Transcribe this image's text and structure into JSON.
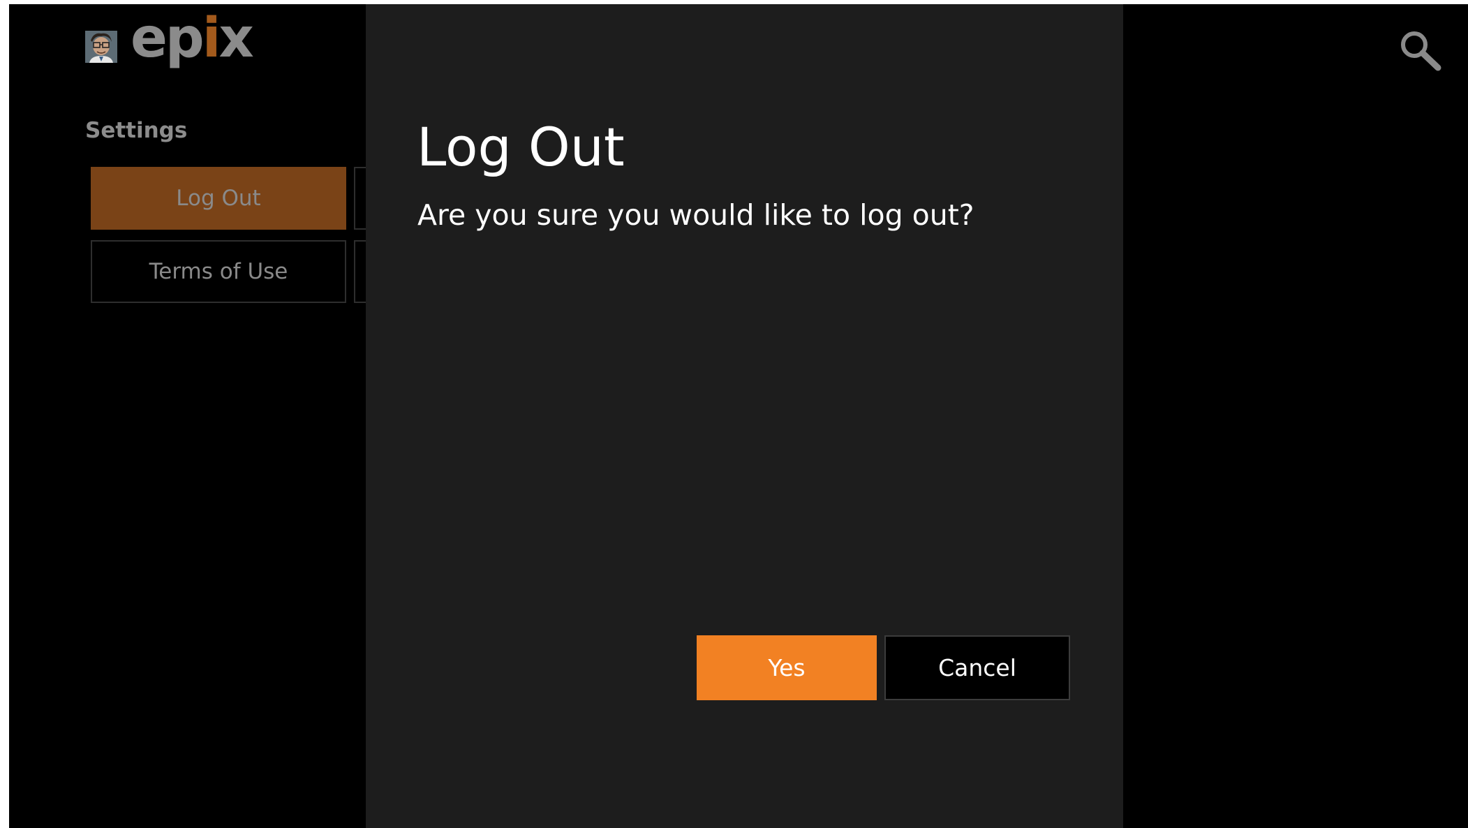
{
  "app": {
    "logo_text_prefix": "ep",
    "logo_text_accent": "i",
    "logo_text_suffix": "x",
    "avatar_icon": "cartoon-avatar-icon",
    "search_icon": "search-icon"
  },
  "settings": {
    "title": "Settings",
    "items": [
      {
        "label": "Log Out",
        "selected": true
      },
      {
        "label": "Terms of Use",
        "selected": false
      }
    ]
  },
  "dialog": {
    "title": "Log Out",
    "message": "Are you sure you would like to log out?",
    "confirm_label": "Yes",
    "cancel_label": "Cancel"
  },
  "colors": {
    "accent": "#f28123",
    "accent_dimmed": "#7a4317",
    "dialog_background": "#1d1d1d",
    "screen_background": "#000000"
  }
}
